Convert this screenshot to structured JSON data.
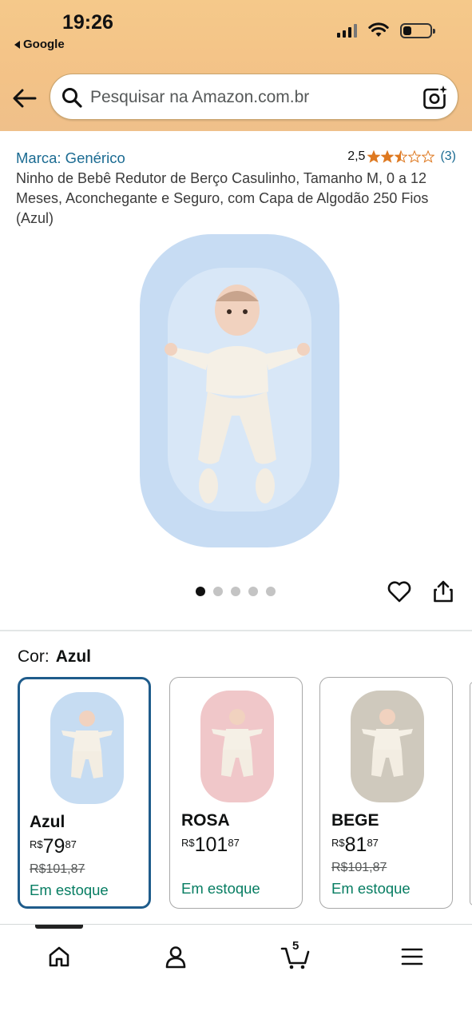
{
  "status_bar": {
    "time": "19:26",
    "back_app": "Google"
  },
  "search": {
    "placeholder": "Pesquisar na Amazon.com.br"
  },
  "product": {
    "brand": "Marca: Genérico",
    "rating_value": "2,5",
    "rating_stars": 2.5,
    "rating_count": "(3)",
    "title": "Ninho de Bebê Redutor de Berço Casulinho, Tamanho M, 0 a 12 Meses, Aconchegante e Seguro, com Capa de Algodão 250 Fios (Azul)"
  },
  "gallery": {
    "image_count": 5,
    "active_index": 0
  },
  "color_selector": {
    "label": "Cor:",
    "selected": "Azul",
    "options": [
      {
        "name": "Azul",
        "currency": "R$",
        "price_int": "79",
        "price_cents": "87",
        "old_price": "R$101,87",
        "stock": "Em estoque",
        "color": "#c6dcf2"
      },
      {
        "name": "ROSA",
        "currency": "R$",
        "price_int": "101",
        "price_cents": "87",
        "old_price": "",
        "stock": "Em estoque",
        "color": "#f0c7c9"
      },
      {
        "name": "BEGE",
        "currency": "R$",
        "price_int": "81",
        "price_cents": "87",
        "old_price": "R$101,87",
        "stock": "Em estoque",
        "color": "#cfc9bd"
      }
    ]
  },
  "bottom_nav": {
    "items": [
      "home",
      "account",
      "cart",
      "menu"
    ],
    "cart_count": "5"
  },
  "colors": {
    "header": "#f3c287",
    "link": "#1b6b92",
    "stock_green": "#067d62",
    "star": "#de7921",
    "selected_border": "#1f5c8b"
  }
}
